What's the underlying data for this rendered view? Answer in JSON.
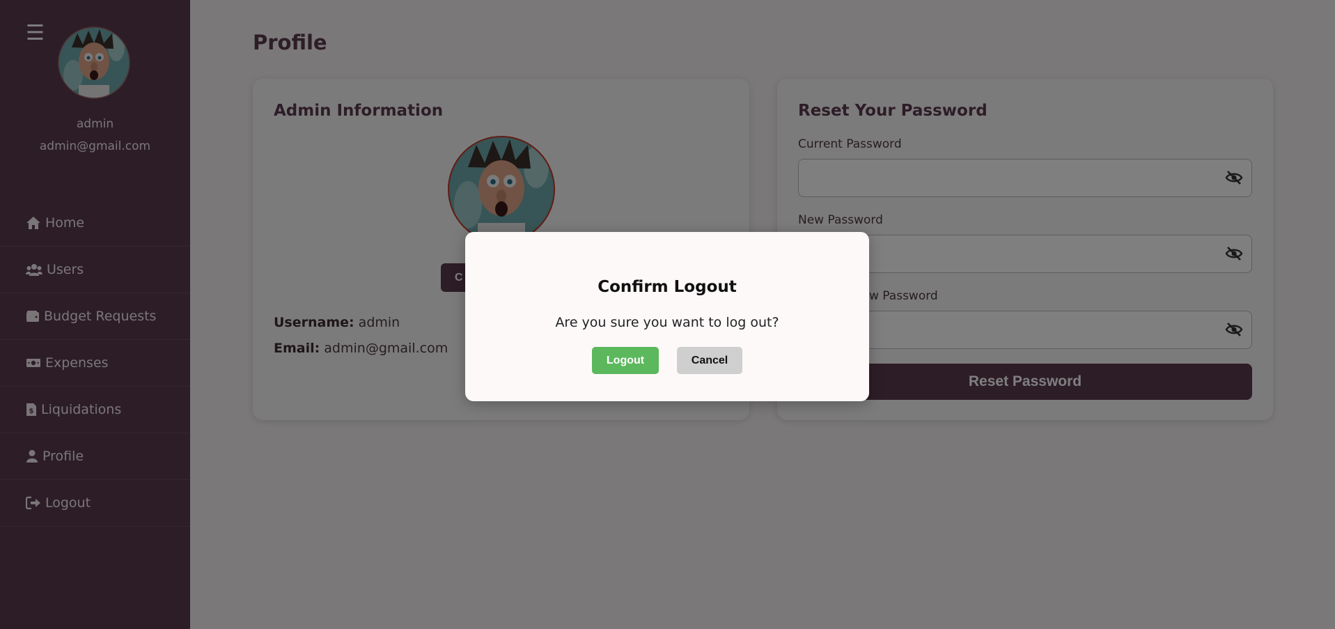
{
  "sidebar": {
    "menu_icon": "hamburger-icon",
    "user": {
      "name": "admin",
      "email": "admin@gmail.com"
    },
    "items": [
      {
        "label": "Home",
        "icon": "home-icon"
      },
      {
        "label": "Users",
        "icon": "users-icon"
      },
      {
        "label": "Budget Requests",
        "icon": "wallet-icon"
      },
      {
        "label": "Expenses",
        "icon": "money-bill-icon"
      },
      {
        "label": "Liquidations",
        "icon": "invoice-dollar-icon"
      },
      {
        "label": "Profile",
        "icon": "user-icon"
      },
      {
        "label": "Logout",
        "icon": "sign-out-icon"
      }
    ]
  },
  "page": {
    "title": "Profile"
  },
  "admin_card": {
    "title": "Admin Information",
    "change_button_label": "C",
    "username_label": "Username:",
    "username_value": "admin",
    "email_label": "Email:",
    "email_value": "admin@gmail.com"
  },
  "password_card": {
    "title": "Reset Your Password",
    "current_label": "Current Password",
    "new_label": "New Password",
    "confirm_label": "w Password",
    "current_value": "",
    "new_value": "",
    "confirm_value": "",
    "visibility_icon": "eye-slash-icon",
    "reset_button_label": "Reset Password"
  },
  "modal": {
    "title": "Confirm Logout",
    "message": "Are you sure you want to log out?",
    "logout_label": "Logout",
    "cancel_label": "Cancel"
  },
  "colors": {
    "sidebar_bg": "#5b3b4e",
    "accent": "#5b3b4e",
    "logout_button": "#5cb85c",
    "cancel_button": "#cfcfcf",
    "page_bg": "#f4f0f1"
  }
}
